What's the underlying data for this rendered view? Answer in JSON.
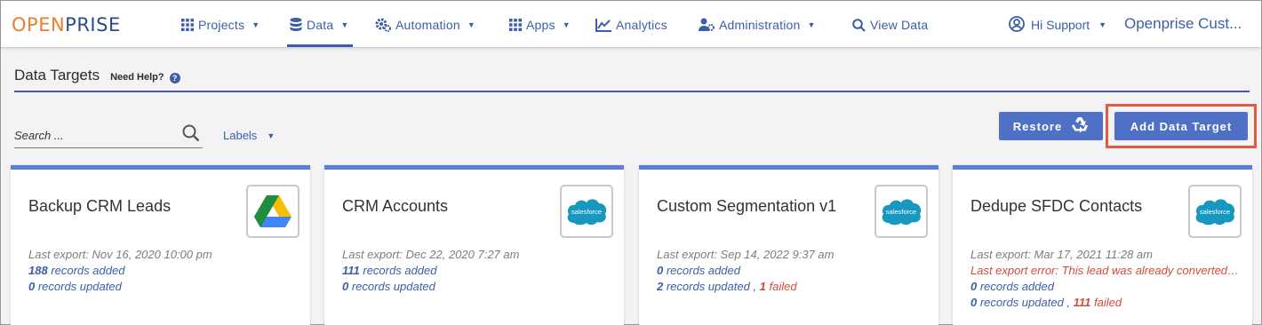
{
  "nav": {
    "logo_part1": "OPEN",
    "logo_part2": "PRISE",
    "items": [
      {
        "label": "Projects"
      },
      {
        "label": "Data"
      },
      {
        "label": "Automation"
      },
      {
        "label": "Apps"
      },
      {
        "label": "Analytics"
      },
      {
        "label": "Administration"
      },
      {
        "label": "View Data"
      }
    ],
    "user_label": "Hi Support",
    "org_label": "Openprise Cust..."
  },
  "page": {
    "title": "Data Targets",
    "help_label": "Need Help?",
    "help_icon_text": "?"
  },
  "toolbar": {
    "search_placeholder": "Search ...",
    "labels_dropdown": "Labels",
    "restore_label": "Restore",
    "add_label": "Add Data Target"
  },
  "cards": [
    {
      "title": "Backup CRM Leads",
      "logo_icon": "google-drive-icon",
      "last_export": "Last export: Nov 16, 2020 10:00 pm",
      "added_count": "188",
      "added_text": " records added",
      "updated_count": "0",
      "updated_text": " records updated"
    },
    {
      "title": "CRM Accounts",
      "logo_icon": "salesforce-icon",
      "last_export": "Last export: Dec 22, 2020 7:27 am",
      "added_count": "111",
      "added_text": " records added",
      "updated_count": "0",
      "updated_text": " records updated"
    },
    {
      "title": "Custom Segmentation v1",
      "logo_icon": "salesforce-icon",
      "last_export": "Last export: Sep 14, 2022 9:37 am",
      "added_count": "0",
      "added_text": " records added",
      "updated_count": "2",
      "updated_text": " records updated ,",
      "failed_count": "1",
      "failed_text": " failed"
    },
    {
      "title": "Dedupe SFDC Contacts",
      "logo_icon": "salesforce-icon",
      "last_export": "Last export: Mar 17, 2021 11:28 am",
      "error_text": "Last export error: This lead was already converted to a contact",
      "added_count": "0",
      "added_text": " records added",
      "updated_count": "0",
      "updated_text": " records updated ,",
      "failed_count": "111",
      "failed_text": " failed"
    }
  ],
  "salesforce_logo_text": "salesforce",
  "colors": {
    "brand_blue": "#3a5fa8",
    "button_blue": "#4e71c6",
    "card_accent": "#5b7fd6",
    "logo_orange": "#ef7d2d",
    "error_red": "#d44a3a",
    "highlight": "#e05a40",
    "salesforce_blue": "#1798c1"
  }
}
